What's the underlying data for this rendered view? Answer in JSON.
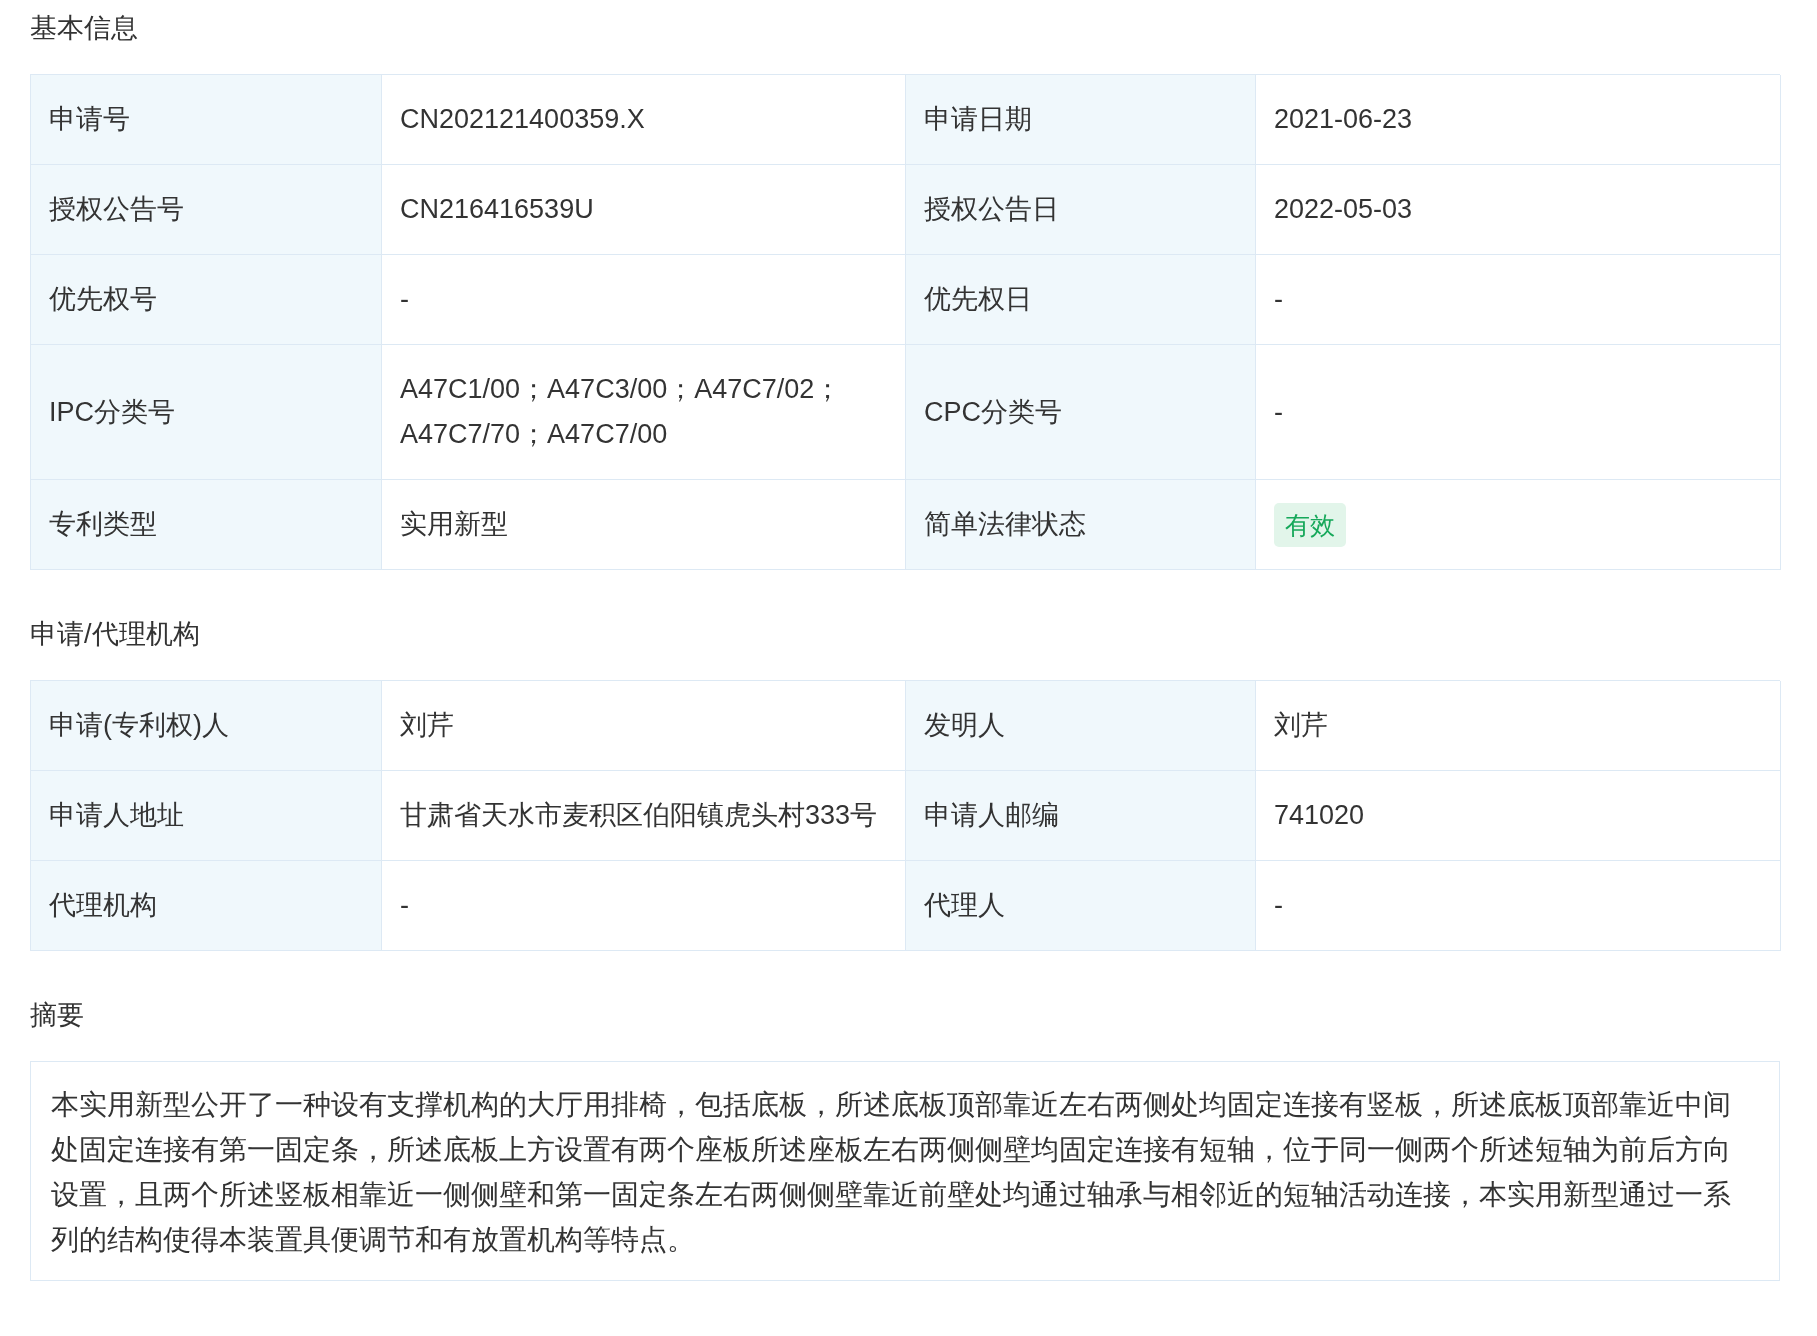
{
  "sections": [
    {
      "title": "基本信息",
      "kind": "table",
      "rows": [
        {
          "cells": [
            {
              "label": "申请号",
              "value": "CN202121400359.X",
              "kind": "text"
            },
            {
              "label": "申请日期",
              "value": "2021-06-23",
              "kind": "text"
            }
          ]
        },
        {
          "cells": [
            {
              "label": "授权公告号",
              "value": "CN216416539U",
              "kind": "text"
            },
            {
              "label": "授权公告日",
              "value": "2022-05-03",
              "kind": "text"
            }
          ]
        },
        {
          "cells": [
            {
              "label": "优先权号",
              "value": "-",
              "kind": "text"
            },
            {
              "label": "优先权日",
              "value": "-",
              "kind": "text"
            }
          ]
        },
        {
          "cells": [
            {
              "label": "IPC分类号",
              "value": "A47C1/00；A47C3/00；A47C7/02；A47C7/70；A47C7/00",
              "kind": "text"
            },
            {
              "label": "CPC分类号",
              "value": "-",
              "kind": "text"
            }
          ]
        },
        {
          "cells": [
            {
              "label": "专利类型",
              "value": "实用新型",
              "kind": "text"
            },
            {
              "label": "简单法律状态",
              "value": "有效",
              "kind": "badge"
            }
          ]
        }
      ]
    },
    {
      "title": "申请/代理机构",
      "kind": "table",
      "rows": [
        {
          "cells": [
            {
              "label": "申请(专利权)人",
              "value": "刘芹",
              "kind": "text"
            },
            {
              "label": "发明人",
              "value": "刘芹",
              "kind": "text"
            }
          ]
        },
        {
          "cells": [
            {
              "label": "申请人地址",
              "value": "甘肃省天水市麦积区伯阳镇虎头村333号",
              "kind": "text"
            },
            {
              "label": "申请人邮编",
              "value": "741020",
              "kind": "text"
            }
          ]
        },
        {
          "cells": [
            {
              "label": "代理机构",
              "value": "-",
              "kind": "text"
            },
            {
              "label": "代理人",
              "value": "-",
              "kind": "text"
            }
          ]
        }
      ]
    },
    {
      "title": "摘要",
      "kind": "text",
      "text": "本实用新型公开了一种设有支撑机构的大厅用排椅，包括底板，所述底板顶部靠近左右两侧处均固定连接有竖板，所述底板顶部靠近中间处固定连接有第一固定条，所述底板上方设置有两个座板所述座板左右两侧侧壁均固定连接有短轴，位于同一侧两个所述短轴为前后方向设置，且两个所述竖板相靠近一侧侧壁和第一固定条左右两侧侧壁靠近前壁处均通过轴承与相邻近的短轴活动连接，本实用新型通过一系列的结构使得本装置具便调节和有放置机构等特点。"
    }
  ]
}
